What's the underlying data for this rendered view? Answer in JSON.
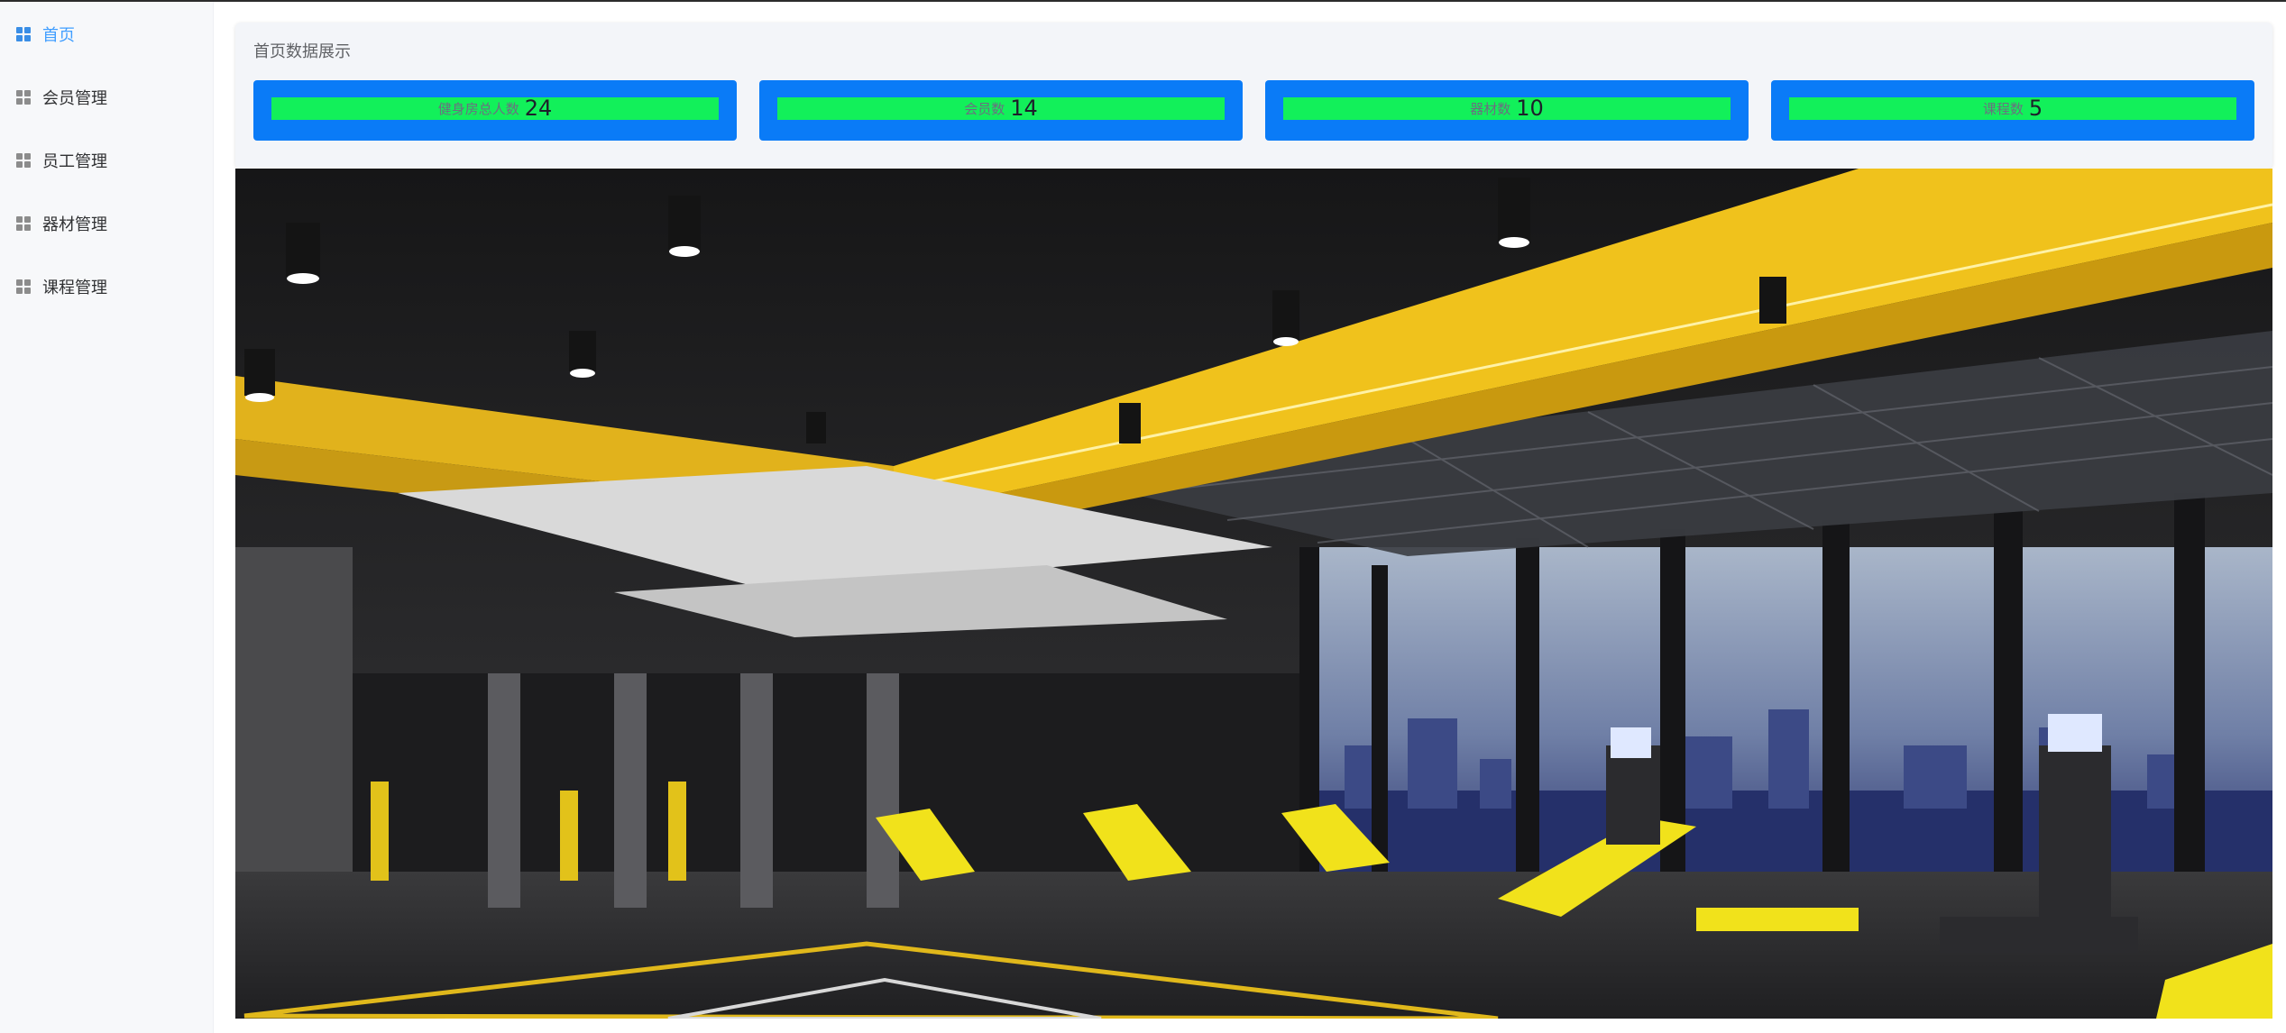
{
  "sidebar": {
    "items": [
      {
        "label": "首页",
        "icon": "grid-icon",
        "active": true
      },
      {
        "label": "会员管理",
        "icon": "grid-icon",
        "active": false
      },
      {
        "label": "员工管理",
        "icon": "grid-icon",
        "active": false
      },
      {
        "label": "器材管理",
        "icon": "grid-icon",
        "active": false
      },
      {
        "label": "课程管理",
        "icon": "grid-icon",
        "active": false
      }
    ]
  },
  "stats": {
    "title": "首页数据展示",
    "cards": [
      {
        "label": "健身房总人数",
        "value": "24"
      },
      {
        "label": "会员数",
        "value": "14"
      },
      {
        "label": "器材数",
        "value": "10"
      },
      {
        "label": "课程数",
        "value": "5"
      }
    ]
  },
  "hero": {
    "description_icon": "gym-photo"
  },
  "colors": {
    "active": "#409eff",
    "card_bg": "#0a7bf7",
    "card_bar": "#12f05a",
    "accent_yellow": "#f2c41a"
  }
}
